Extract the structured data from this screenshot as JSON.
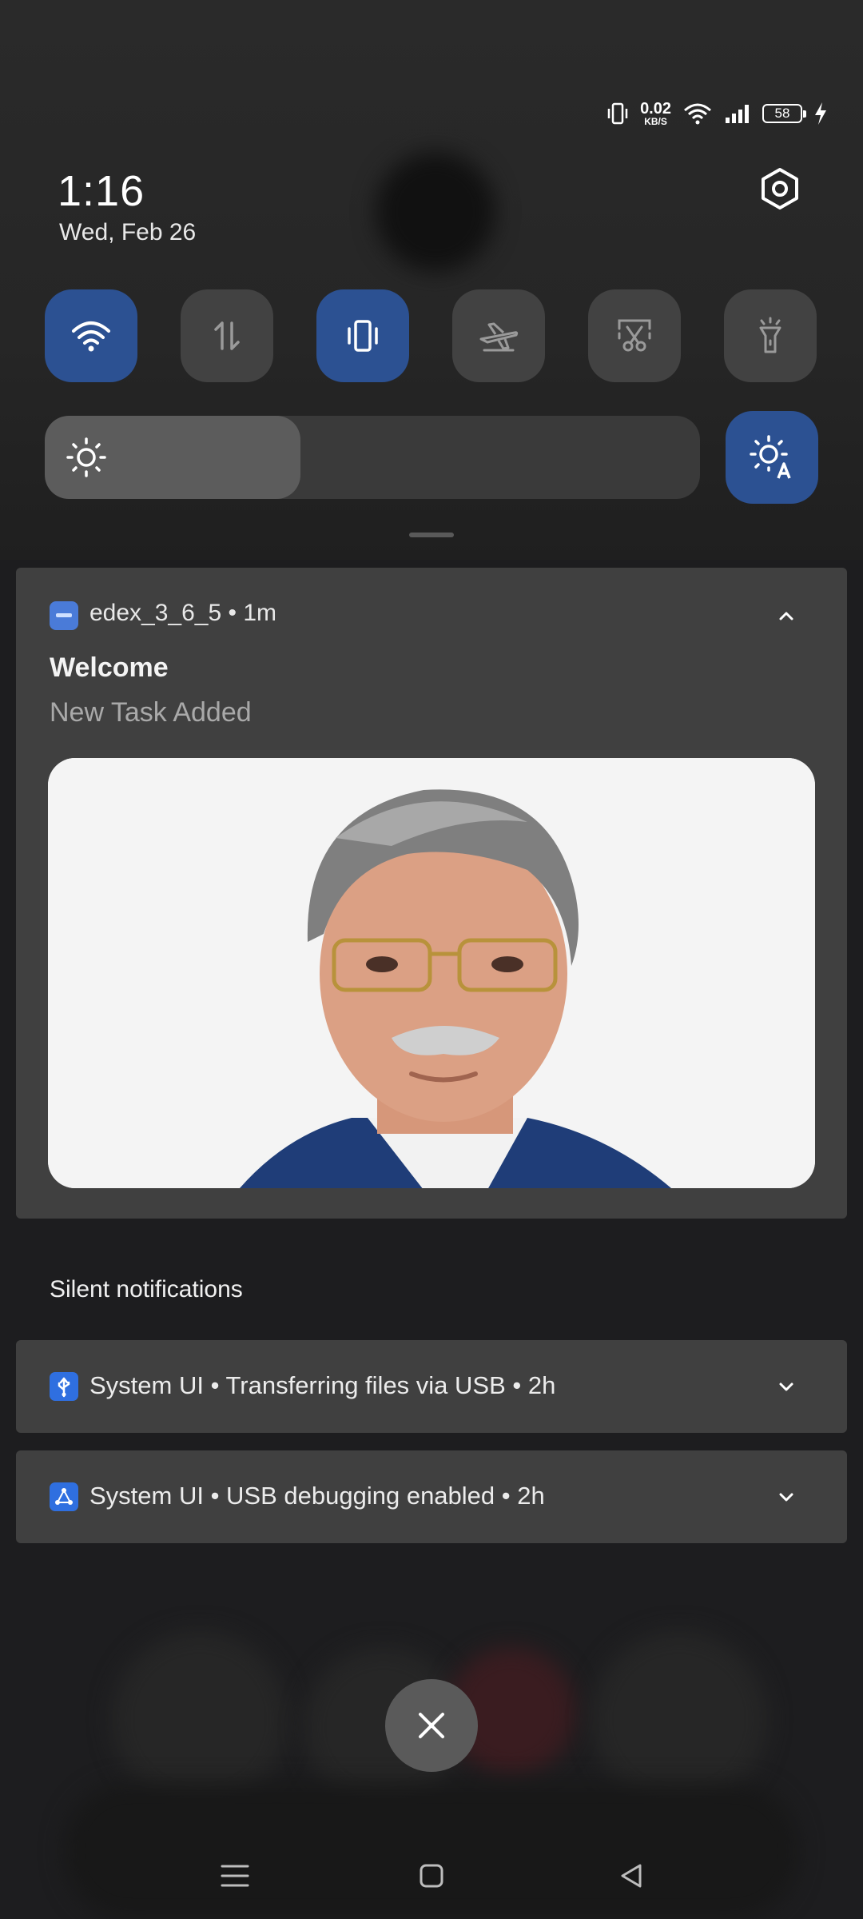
{
  "status_bar": {
    "net_speed_value": "0.02",
    "net_speed_unit": "KB/S",
    "battery_level": "58",
    "icons": [
      "vibrate-icon",
      "wifi-icon",
      "signal-icon",
      "battery-icon",
      "charging-icon"
    ]
  },
  "header": {
    "time": "1:16",
    "date": "Wed, Feb 26"
  },
  "quick_tiles": [
    {
      "name": "wifi",
      "icon": "wifi-icon",
      "on": true
    },
    {
      "name": "mobile-data",
      "icon": "mobile-data-icon",
      "on": false
    },
    {
      "name": "vibrate",
      "icon": "vibrate-icon",
      "on": true
    },
    {
      "name": "airplane-mode",
      "icon": "airplane-icon",
      "on": false
    },
    {
      "name": "screenshot",
      "icon": "scissors-icon",
      "on": false
    },
    {
      "name": "flashlight",
      "icon": "flashlight-icon",
      "on": false
    }
  ],
  "brightness": {
    "level": 0.39,
    "auto_brightness_on": true
  },
  "notification": {
    "app_name": "edex_3_6_5",
    "time_ago": "1m",
    "header_text": "edex_3_6_5 • 1m",
    "title": "Welcome",
    "text": "New Task Added"
  },
  "silent_section": {
    "label": "Silent notifications",
    "items": [
      {
        "icon": "usb-icon",
        "text": "System UI • Transferring files via USB • 2h"
      },
      {
        "icon": "usb-debug-icon",
        "text": "System UI • USB debugging enabled • 2h"
      }
    ]
  },
  "colors": {
    "accent_tile": "#2c5192",
    "tile_off": "#424242",
    "card": "#404040",
    "background": "#1d1d1f"
  }
}
